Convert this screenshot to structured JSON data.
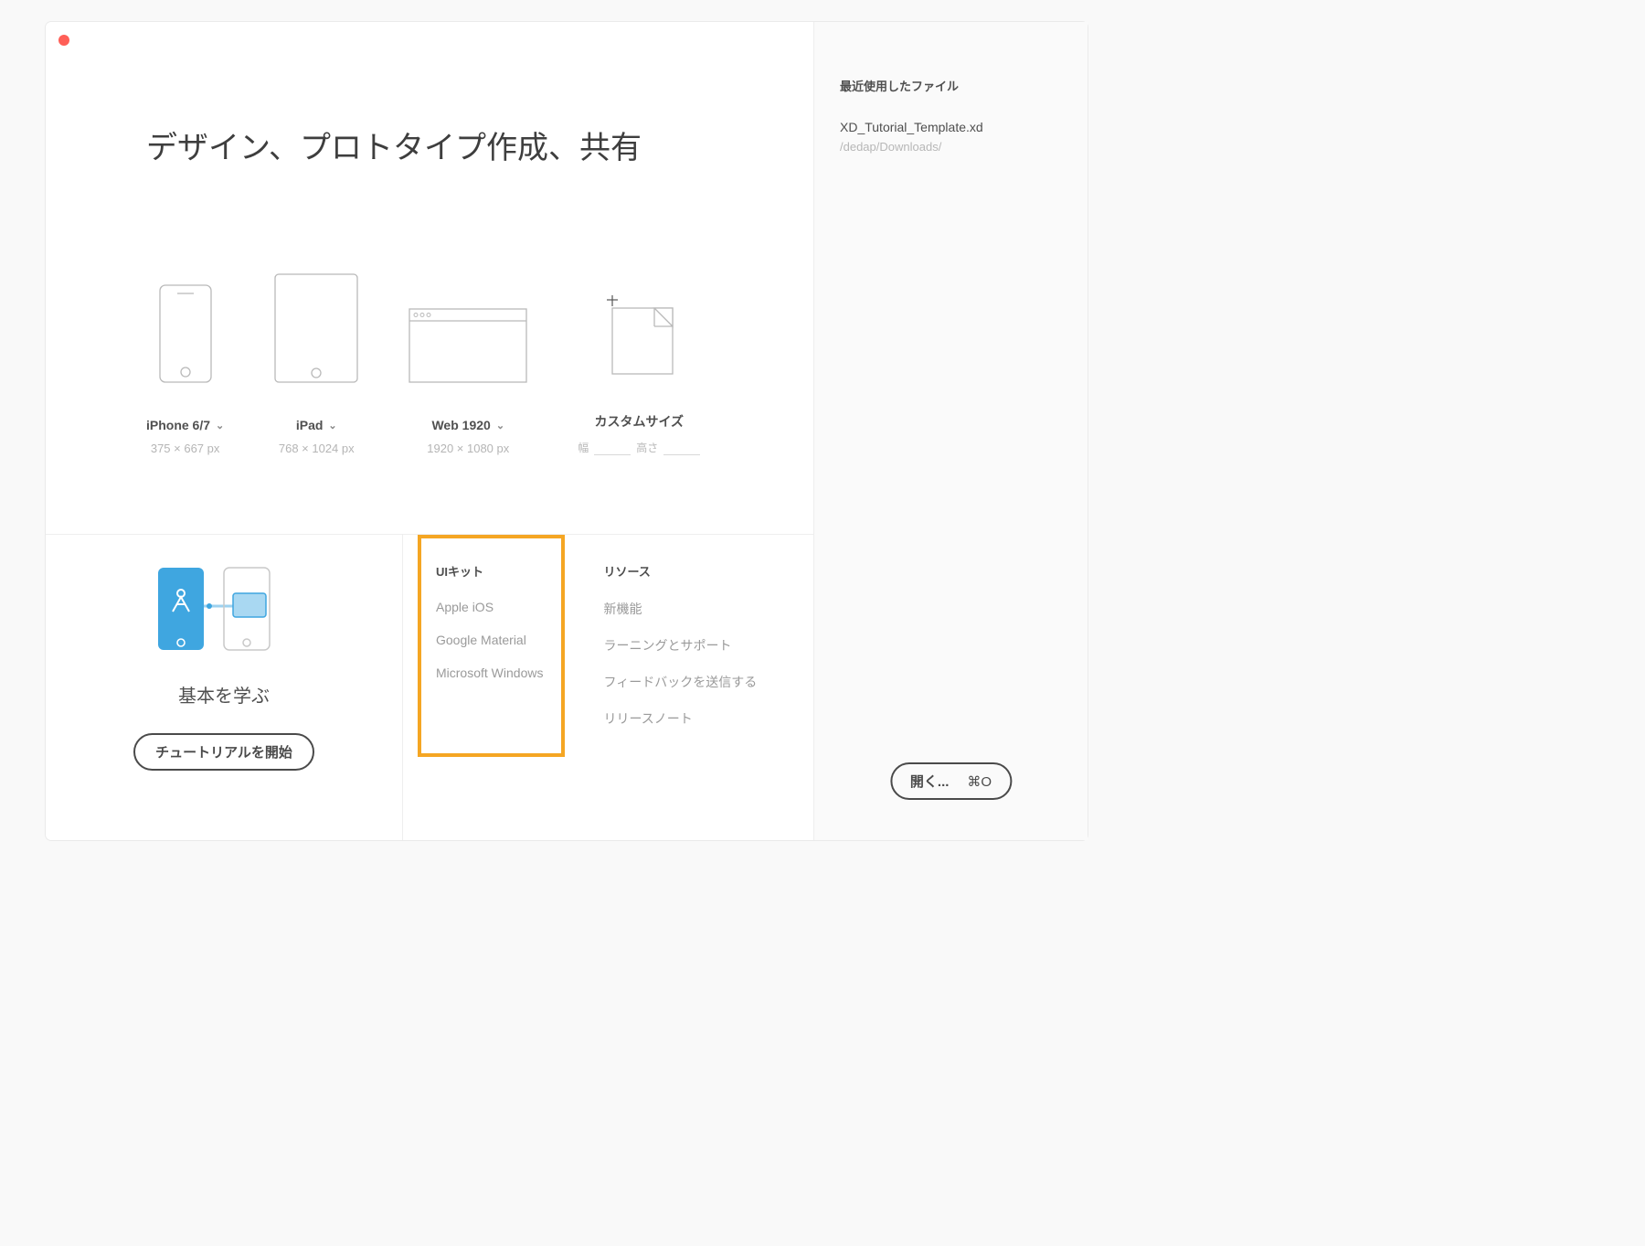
{
  "headline": "デザイン、プロトタイプ作成、共有",
  "presets": [
    {
      "label": "iPhone 6/7",
      "dim": "375 × 667 px",
      "hasChevron": true
    },
    {
      "label": "iPad",
      "dim": "768 × 1024 px",
      "hasChevron": true
    },
    {
      "label": "Web 1920",
      "dim": "1920 × 1080 px",
      "hasChevron": true
    },
    {
      "label": "カスタムサイズ",
      "widthLabel": "幅",
      "heightLabel": "高さ"
    }
  ],
  "sidebar": {
    "recentTitle": "最近使用したファイル",
    "recentFile": "XD_Tutorial_Template.xd",
    "recentPath": "/dedap/Downloads/",
    "openLabel": "開く...",
    "openShortcut": "⌘O"
  },
  "learn": {
    "title": "基本を学ぶ",
    "button": "チュートリアルを開始"
  },
  "uiKits": {
    "title": "UIキット",
    "items": [
      "Apple iOS",
      "Google Material",
      "Microsoft Windows"
    ]
  },
  "resources": {
    "title": "リソース",
    "items": [
      "新機能",
      "ラーニングとサポート",
      "フィードバックを送信する",
      "リリースノート"
    ]
  }
}
